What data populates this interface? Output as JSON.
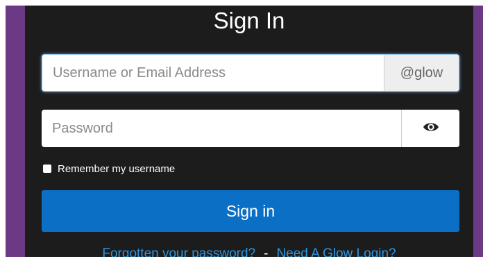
{
  "colors": {
    "panel_bg": "#1d1c1d",
    "brand_purple": "#6c3a85",
    "primary_button": "#0b6fc6",
    "link": "#2e94de"
  },
  "form": {
    "title": "Sign In",
    "username": {
      "placeholder": "Username or Email Address",
      "value": "",
      "suffix": "@glow"
    },
    "password": {
      "placeholder": "Password",
      "value": "",
      "toggle_icon": "eye-icon"
    },
    "remember": {
      "label": "Remember my username",
      "checked": false
    },
    "submit_label": "Sign in"
  },
  "links": {
    "forgot_password": "Forgotten your password?",
    "separator": "-",
    "need_login": "Need A Glow Login?"
  }
}
